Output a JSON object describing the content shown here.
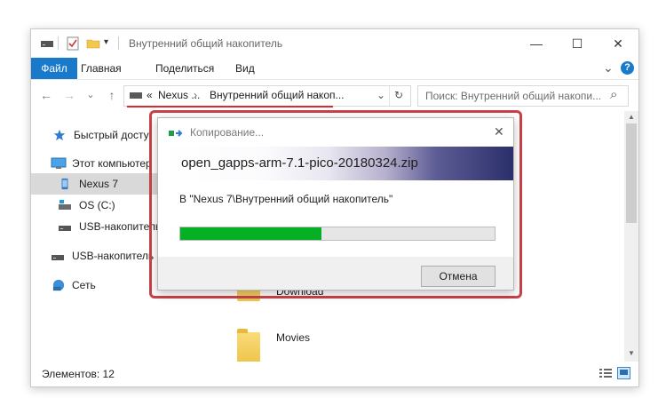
{
  "window": {
    "title": "Внутренний общий накопитель",
    "minimize_glyph": "—",
    "maximize_glyph": "☐",
    "close_glyph": "✕"
  },
  "ribbon": {
    "tabs": [
      "Файл",
      "Главная",
      "Поделиться",
      "Вид"
    ],
    "help_glyph": "?",
    "expand_glyph": "⌄"
  },
  "navigation": {
    "back_glyph": "←",
    "forward_glyph": "→",
    "recent_glyph": "⌄",
    "up_glyph": "↑",
    "address_prefix": "«",
    "address_crumbs": [
      "Nexus ...",
      "Внутренний общий накоп..."
    ],
    "address_separator": "›",
    "address_dropdown_glyph": "⌄",
    "refresh_glyph": "↻",
    "search_placeholder": "Поиск: Внутренний общий накопи...",
    "search_icon_glyph": "⌕"
  },
  "sidebar": {
    "items": [
      {
        "label": "Быстрый досту",
        "icon": "star-icon"
      },
      {
        "label": "Этот компьютер",
        "icon": "computer-icon"
      },
      {
        "label": "Nexus 7",
        "icon": "phone-icon",
        "selected": true
      },
      {
        "label": "OS (C:)",
        "icon": "drive-icon"
      },
      {
        "label": "USB-накопитель",
        "icon": "usb-drive-icon"
      },
      {
        "label": "USB-накопитель (I",
        "icon": "usb-drive-icon"
      },
      {
        "label": "Сеть",
        "icon": "network-icon"
      }
    ]
  },
  "content": {
    "folders": [
      {
        "label": "Download"
      },
      {
        "label": "Movies"
      }
    ]
  },
  "statusbar": {
    "items_count": "Элементов: 12"
  },
  "dialog": {
    "title": "Копирование...",
    "close_glyph": "✕",
    "file_name": "open_gapps-arm-7.1-pico-20180324.zip",
    "destination": "В \"Nexus 7\\Внутренний общий накопитель\"",
    "progress_fraction": 0.45,
    "cancel_label": "Отмена"
  },
  "colors": {
    "accent": "#1979ca",
    "progress": "#06b025",
    "highlight_frame": "#c84148"
  }
}
